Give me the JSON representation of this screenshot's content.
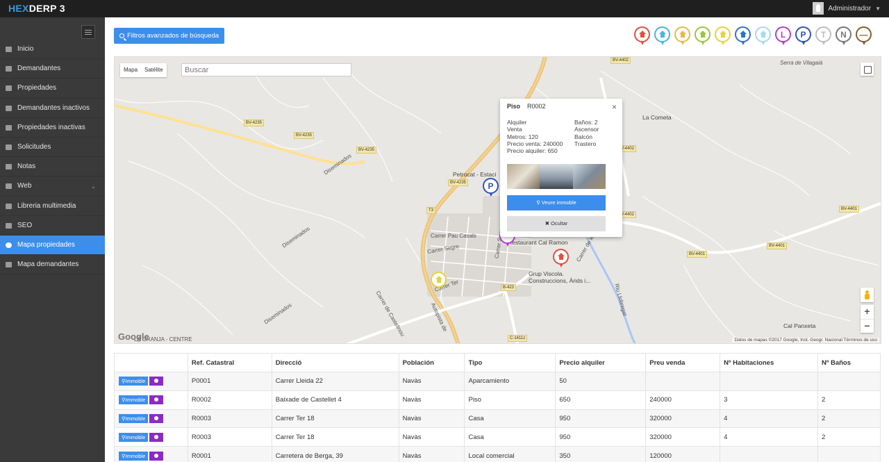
{
  "app": {
    "logo_prefix": "HEX",
    "logo_suffix": "DERP 3",
    "user": "Administrador"
  },
  "sidebar": {
    "items": [
      {
        "label": "Inicio",
        "icon": "home-icon"
      },
      {
        "label": "Demandantes",
        "icon": "users-icon"
      },
      {
        "label": "Propiedades",
        "icon": "pin-icon"
      },
      {
        "label": "Demandantes inactivos",
        "icon": "users-icon"
      },
      {
        "label": "Propiedades inactivas",
        "icon": "users-icon"
      },
      {
        "label": "Solicitudes",
        "icon": "envelope-icon"
      },
      {
        "label": "Notas",
        "icon": "tag-icon"
      },
      {
        "label": "Web",
        "icon": "monitor-icon"
      },
      {
        "label": "Libreria multimedia",
        "icon": "image-icon"
      },
      {
        "label": "SEO",
        "icon": "tag-icon"
      },
      {
        "label": "Mapa propiedades",
        "icon": "globe-icon"
      },
      {
        "label": "Mapa demandantes",
        "icon": "globe-icon"
      }
    ],
    "active": "Mapa propiedades"
  },
  "toolbar": {
    "filter_label": "Filtros avanzados de búsqueda"
  },
  "legend_markers": [
    {
      "color": "#e74c3c",
      "glyph": ""
    },
    {
      "color": "#4ab3e8",
      "glyph": ""
    },
    {
      "color": "#e8b84a",
      "glyph": ""
    },
    {
      "color": "#9bc53d",
      "glyph": ""
    },
    {
      "color": "#e8d13a",
      "glyph": ""
    },
    {
      "color": "#2e73c9",
      "glyph": ""
    },
    {
      "color": "#a7d8f0",
      "glyph": ""
    },
    {
      "color": "#b93bd3",
      "glyph": "L"
    },
    {
      "color": "#2e54b8",
      "glyph": "P"
    },
    {
      "color": "#bdbdbd",
      "glyph": "T"
    },
    {
      "color": "#777777",
      "glyph": "N"
    },
    {
      "color": "#8b5a2b",
      "glyph": "—"
    }
  ],
  "map": {
    "type_buttons": [
      "Mapa",
      "Satélite"
    ],
    "search_placeholder": "Buscar",
    "attribution": "Datos de mapas ©2017 Google, Inst. Geogr. Nacional     Términos de uso",
    "google": "Google",
    "labels": {
      "serra": "Serra de Vilagaià",
      "cometa": "La Cometa",
      "petrocat": "Petrocat - Estaci",
      "restaurant": "Restaurant Cal Ramon",
      "viscola": "Grup Viscola. Construccions, Àrids i...",
      "carrer_ter": "Carrer Ter",
      "pau_casals": "Carrer Pau Casals",
      "segre": "Carrer Segre",
      "granja": "LA GRANJA - CENTRE",
      "panxeta": "Cal Panxeta",
      "diseminados": "Diseminados",
      "santa_eulalia": "Carrer Santa Eulàlia",
      "castellnou": "Carrer de Castellnou",
      "autopista": "Autopista de",
      "llobregat": "Riu Llobregat",
      "fonts": "Carrer de les Fonts"
    },
    "road_tags": [
      "BV-4402",
      "BV-4235",
      "BV-4235",
      "BV-4235",
      "BV-4402",
      "BV-4402",
      "BV-4401",
      "BV-4401",
      "BV-4401",
      "BV-4235",
      "C-1411z",
      "B-423",
      "T3"
    ]
  },
  "infowindow": {
    "type": "Piso",
    "ref": "R0002",
    "left": [
      "Alquiler",
      "Venta",
      "Metros: 120",
      "Precio venta: 240000",
      "Precio alquiler: 650"
    ],
    "right": [
      "Baños: 2",
      "Ascensor",
      "Balcón",
      "Trastero"
    ],
    "view_label": "Veure immoble",
    "hide_label": "Ocultar",
    "close": "×"
  },
  "table": {
    "headers": [
      "",
      "Ref. Catastral",
      "Direcció",
      "Población",
      "Tipo",
      "Precio alquiler",
      "Preu venda",
      "Nº Habitaciones",
      "Nº Baños"
    ],
    "action_label": "Immoble",
    "rows": [
      [
        "P0001",
        "Carrer Lleida 22",
        "Navàs",
        "Aparcamiento",
        "50",
        "",
        "",
        ""
      ],
      [
        "R0002",
        "Baixade de Castellet 4",
        "Navàs",
        "Piso",
        "650",
        "240000",
        "3",
        "2"
      ],
      [
        "R0003",
        "Carrer Ter 18",
        "Navàs",
        "Casa",
        "950",
        "320000",
        "4",
        "2"
      ],
      [
        "R0003",
        "Carrer Ter 18",
        "Navàs",
        "Casa",
        "950",
        "320000",
        "4",
        "2"
      ],
      [
        "R0001",
        "Carretera de Berga, 39",
        "Navàs",
        "Local comercial",
        "350",
        "120000",
        "",
        ""
      ]
    ]
  }
}
